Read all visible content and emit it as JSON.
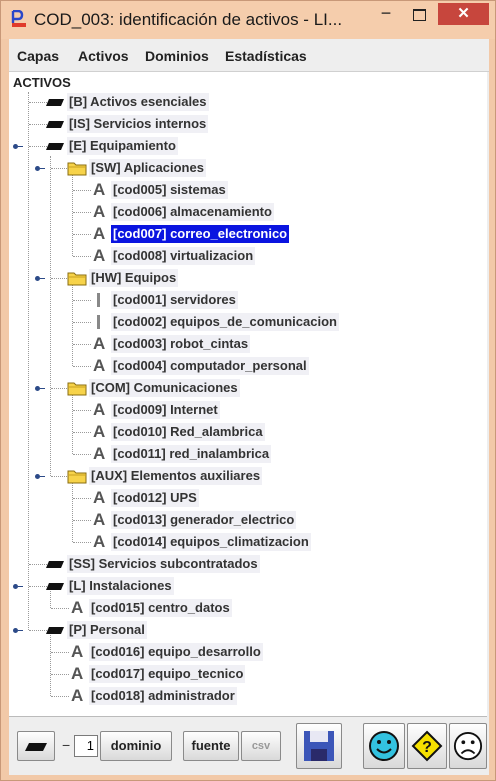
{
  "window": {
    "title": "COD_003: identificación de activos - LI...",
    "minimize_label": "−",
    "close_label": "✕"
  },
  "menu": [
    "Capas",
    "Activos",
    "Dominios",
    "Estadísticas"
  ],
  "tree": {
    "root": "ACTIVOS",
    "nodes": [
      {
        "label": "[B] Activos esenciales",
        "icon": "layer-icon"
      },
      {
        "label": "[IS] Servicios internos",
        "icon": "layer-icon"
      },
      {
        "label": "[E] Equipamiento",
        "icon": "layer-icon"
      },
      {
        "label": "[SW] Aplicaciones",
        "icon": "folder-icon"
      },
      {
        "label": "[cod005] sistemas",
        "icon": "asset-a-icon"
      },
      {
        "label": "[cod006] almacenamiento",
        "icon": "asset-a-icon"
      },
      {
        "label": "[cod007] correo_electronico",
        "icon": "asset-a-icon",
        "selected": true
      },
      {
        "label": "[cod008] virtualizacion",
        "icon": "asset-a-icon"
      },
      {
        "label": "[HW] Equipos",
        "icon": "folder-icon"
      },
      {
        "label": "[cod001] servidores",
        "icon": "asset-bar-icon"
      },
      {
        "label": "[cod002] equipos_de_comunicacion",
        "icon": "asset-bar-icon"
      },
      {
        "label": "[cod003] robot_cintas",
        "icon": "asset-a-icon"
      },
      {
        "label": "[cod004] computador_personal",
        "icon": "asset-a-icon"
      },
      {
        "label": "[COM] Comunicaciones",
        "icon": "folder-icon"
      },
      {
        "label": "[cod009] Internet",
        "icon": "asset-a-icon"
      },
      {
        "label": "[cod010] Red_alambrica",
        "icon": "asset-a-icon"
      },
      {
        "label": "[cod011] red_inalambrica",
        "icon": "asset-a-icon"
      },
      {
        "label": "[AUX] Elementos auxiliares",
        "icon": "folder-icon"
      },
      {
        "label": "[cod012] UPS",
        "icon": "asset-a-icon"
      },
      {
        "label": "[cod013] generador_electrico",
        "icon": "asset-a-icon"
      },
      {
        "label": "[cod014] equipos_climatizacion",
        "icon": "asset-a-icon"
      },
      {
        "label": "[SS] Servicios subcontratados",
        "icon": "layer-icon"
      },
      {
        "label": "[L] Instalaciones",
        "icon": "layer-icon"
      },
      {
        "label": "[cod015] centro_datos",
        "icon": "asset-a-icon"
      },
      {
        "label": "[P] Personal",
        "icon": "layer-icon"
      },
      {
        "label": "[cod016] equipo_desarrollo",
        "icon": "asset-a-icon"
      },
      {
        "label": "[cod017] equipo_tecnico",
        "icon": "asset-a-icon"
      },
      {
        "label": "[cod018] administrador",
        "icon": "asset-a-icon"
      }
    ]
  },
  "toolbar": {
    "minus_label": "−",
    "level_value": "1",
    "dominio_label": "dominio",
    "fuente_label": "fuente",
    "csv_label": "csv"
  },
  "colors": {
    "selection": "#0a14e0",
    "close_button": "#c7463d",
    "smiley": "#33c2e0",
    "warning": "#f5e000"
  }
}
